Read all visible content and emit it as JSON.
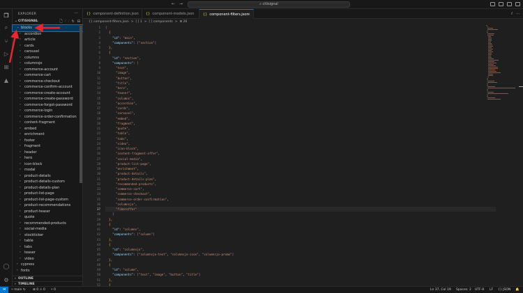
{
  "titlebar": {
    "search_text": "citisignal",
    "back_icon": "arrow-left-icon",
    "forward_icon": "arrow-right-icon"
  },
  "activity_icons": [
    "files-icon",
    "search-icon",
    "source-control-icon",
    "run-debug-icon",
    "extensions-icon",
    "aem-icon",
    "account-icon",
    "manage-gear-icon"
  ],
  "sidebar": {
    "title": "EXPLORER",
    "more": "···",
    "project": "CITISIGNAL",
    "items": [
      {
        "label": "blocks",
        "top": true,
        "open": true,
        "selected": true
      },
      {
        "label": "accordion"
      },
      {
        "label": "article"
      },
      {
        "label": "cards"
      },
      {
        "label": "carousel"
      },
      {
        "label": "columns"
      },
      {
        "label": "columnsjo"
      },
      {
        "label": "commerce-account"
      },
      {
        "label": "commerce-cart"
      },
      {
        "label": "commerce-checkout"
      },
      {
        "label": "commerce-confirm-account"
      },
      {
        "label": "commerce-create-account"
      },
      {
        "label": "commerce-create-password"
      },
      {
        "label": "commerce-forgot-password"
      },
      {
        "label": "commerce-login"
      },
      {
        "label": "commerce-order-confirmation"
      },
      {
        "label": "content-fragment"
      },
      {
        "label": "embed"
      },
      {
        "label": "enrichment"
      },
      {
        "label": "footer"
      },
      {
        "label": "fragment"
      },
      {
        "label": "header"
      },
      {
        "label": "hero"
      },
      {
        "label": "icon-block"
      },
      {
        "label": "modal"
      },
      {
        "label": "product-details"
      },
      {
        "label": "product-details-custom"
      },
      {
        "label": "product-details-plan"
      },
      {
        "label": "product-list-page"
      },
      {
        "label": "product-list-page-custom"
      },
      {
        "label": "product-recommendations"
      },
      {
        "label": "product-teaser"
      },
      {
        "label": "quote"
      },
      {
        "label": "recommended-products"
      },
      {
        "label": "social-media"
      },
      {
        "label": "stockticker"
      },
      {
        "label": "table"
      },
      {
        "label": "tabs"
      },
      {
        "label": "teaser"
      },
      {
        "label": "video"
      },
      {
        "label": "cypress",
        "top": true
      },
      {
        "label": "fonts",
        "top": true
      }
    ],
    "outline": "OUTLINE",
    "timeline": "TIMELINE"
  },
  "tabs": [
    {
      "label": "component-definition.json",
      "active": false
    },
    {
      "label": "component-models.json",
      "active": false
    },
    {
      "label": "component-filters.json",
      "active": true
    }
  ],
  "breadcrumb": [
    "{} component-filters.json",
    ">",
    "[ ] 1",
    ">",
    "[ ] components",
    ">",
    "⊟ 26"
  ],
  "editor": {
    "current_line": 37,
    "lines": [
      "[",
      "  {",
      "    \"id\": \"main\",",
      "    \"components\": [\"section\"]",
      "  },",
      "  {",
      "    \"id\": \"section\",",
      "    \"components\": [",
      "      \"text\",",
      "      \"image\",",
      "      \"button\",",
      "      \"title\",",
      "      \"hero\",",
      "      \"teaser\",",
      "      \"columns\",",
      "      \"accordion\",",
      "      \"cards\",",
      "      \"carousel\",",
      "      \"embed\",",
      "      \"fragment\",",
      "      \"quote\",",
      "      \"table\",",
      "      \"tabs\",",
      "      \"video\",",
      "      \"icon-block\",",
      "      \"content-fragment-offer\",",
      "      \"social-media\",",
      "      \"product-list-page\",",
      "      \"enrichment\",",
      "      \"product-details\",",
      "      \"product-details-plan\",",
      "      \"recommended-products\",",
      "      \"commerce-cart\",",
      "      \"commerce-checkout\",",
      "      \"commerce-order-confirmation\",",
      "      \"columnsjo\",",
      "      \"fiberoffer\"",
      "    ]",
      "  },",
      "  {",
      "    \"id\": \"columns\",",
      "    \"components\": [\"column\"]",
      "  },",
      "  {",
      "    \"id\": \"columnsjo\",",
      "    \"components\": [\"columnsjo-text\", \"columnsjo-icon\", \"columnsjo-promo\"]",
      "  },",
      "  {",
      "    \"id\": \"column\",",
      "    \"components\": [\"text\", \"image\", \"button\", \"title\"]",
      "  },",
      "  {",
      "    \"id\": \"accordion\",",
      "    \"components\": [\"accordion-item\"]"
    ]
  },
  "status": {
    "branch": "main",
    "sync": "↻",
    "problems": "⊗ 0 ⚠ 0",
    "ports": "⑂ 0",
    "position": "Ln 37, Col 19",
    "spaces": "Spaces: 2",
    "encoding": "UTF-8",
    "eol": "LF",
    "language": "{} JSON",
    "bell_icon": "bell-icon"
  },
  "colors": {
    "accent": "#0078d4",
    "annotation_arrow": "#e8262d",
    "json_key": "#9cdcfe",
    "json_string": "#ce9178"
  }
}
